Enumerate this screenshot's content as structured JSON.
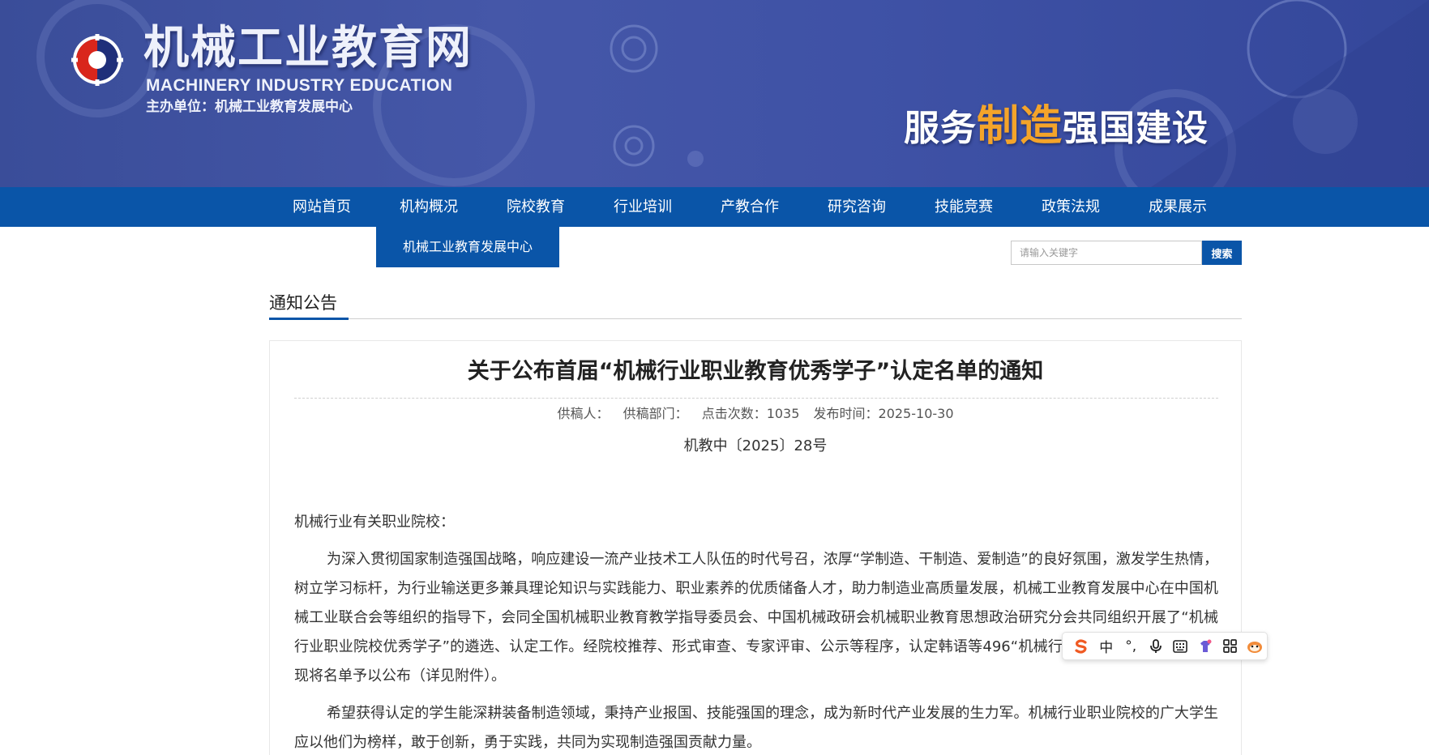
{
  "header": {
    "site_name": "机械工业教育网",
    "site_name_en": "MACHINERY INDUSTRY EDUCATION",
    "sponsor": "主办单位：机械工业教育发展中心",
    "slogan_pre": "服务",
    "slogan_highlight": "制造",
    "slogan_post": "强国建设",
    "colors": {
      "banner": "#3f52a6",
      "nav": "#0a55a8",
      "slogan_highlight": "#f4a42a"
    }
  },
  "nav": {
    "items": [
      "网站首页",
      "机构概况",
      "院校教育",
      "行业培训",
      "产教合作",
      "研究咨询",
      "技能竞赛",
      "政策法规",
      "成果展示"
    ],
    "submenu": [
      "机械工业教育发展中心"
    ]
  },
  "search": {
    "placeholder": "请输入关键字",
    "button": "搜索"
  },
  "section": {
    "title": "通知公告"
  },
  "article": {
    "title": "关于公布首届“机械行业职业教育优秀学子”认定名单的通知",
    "meta": {
      "author": "供稿人：",
      "department": "供稿部门：",
      "views": "点击次数：1035",
      "published": "发布时间：2025-10-30"
    },
    "doc_number": "机教中〔2025〕28号",
    "salutation": "机械行业有关职业院校：",
    "paragraphs": [
      "为深入贯彻国家制造强国战略，响应建设一流产业技术工人队伍的时代号召，浓厚“学制造、干制造、爱制造”的良好氛围，激发学生热情，树立学习标杆，为行业输送更多兼具理论知识与实践能力、职业素养的优质储备人才，助力制造业高质量发展，机械工业教育发展中心在中国机械工业联合会等组织的指导下，会同全国机械职业教育教学指导委员会、中国机械政研会机械职业教育思想政治研究分会共同组织开展了“机械行业职业院校优秀学子”的遴选、认定工作。经院校推荐、形式审查、专家评审、公示等程序，认定韩语等496",
      "“机械行业职业教育优秀学子”，现将名单予以公布（详见附件）。",
      "希望获得认定的学生能深耕装备制造领域，秉持产业报国、技能强国的理念，成为新时代产业发展的生力军。机械行业职业院校的广大学生应以他们为榜样，敢于创新，勇于实践，共同为实现制造强国贡献力量。"
    ]
  },
  "ime_toolbar": {
    "items": [
      {
        "icon": "sogou-logo-icon",
        "label": "S"
      },
      {
        "icon": "chinese-mode-icon",
        "label": "中"
      },
      {
        "icon": "punctuation-icon",
        "label": "°,"
      },
      {
        "icon": "microphone-icon",
        "label": ""
      },
      {
        "icon": "keyboard-icon",
        "label": ""
      },
      {
        "icon": "skin-icon",
        "label": ""
      },
      {
        "icon": "apps-grid-icon",
        "label": ""
      },
      {
        "icon": "mascot-icon",
        "label": ""
      }
    ]
  }
}
